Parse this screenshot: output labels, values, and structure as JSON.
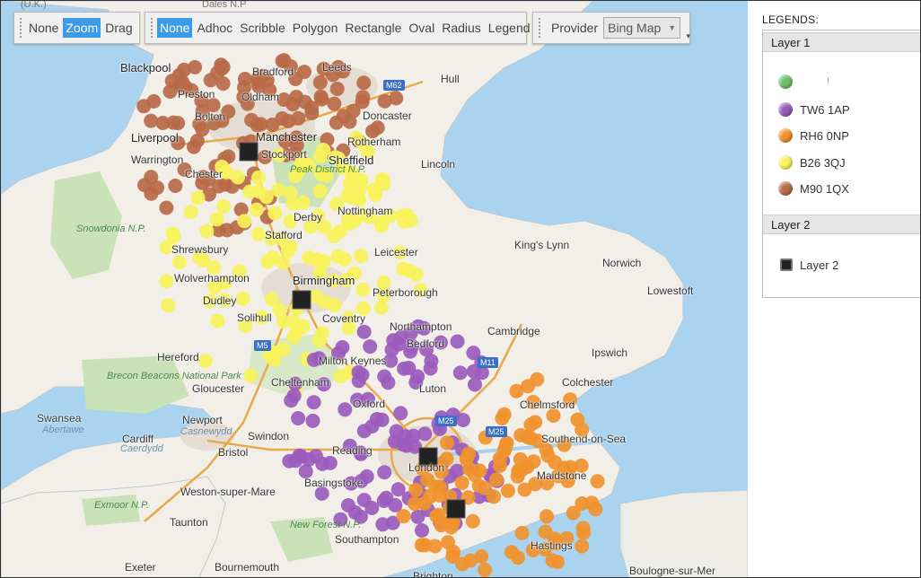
{
  "toolbar": {
    "zoom_group": [
      {
        "label": "None",
        "active": false
      },
      {
        "label": "Zoom",
        "active": true
      },
      {
        "label": "Drag",
        "active": false
      }
    ],
    "draw_group": [
      {
        "label": "None",
        "active": true
      },
      {
        "label": "Adhoc",
        "active": false
      },
      {
        "label": "Scribble",
        "active": false
      },
      {
        "label": "Polygon",
        "active": false
      },
      {
        "label": "Rectangle",
        "active": false
      },
      {
        "label": "Oval",
        "active": false
      },
      {
        "label": "Radius",
        "active": false
      },
      {
        "label": "Legend",
        "active": false
      }
    ],
    "provider_label": "Provider",
    "provider_value": "Bing Map"
  },
  "map": {
    "top_fragments": [
      "(U.K.)",
      "Dales N.P"
    ],
    "places": [
      "Blackpool",
      "Preston",
      "Bradford",
      "Leeds",
      "Hull",
      "Bolton",
      "Oldham",
      "Liverpool",
      "Manchester",
      "Doncaster",
      "Warrington",
      "Stockport",
      "Sheffield",
      "Rotherham",
      "Chester",
      "Lincoln",
      "Peak District N.P.",
      "Derby",
      "Nottingham",
      "Snowdonia N.P.",
      "Stafford",
      "Shrewsbury",
      "Leicester",
      "King's Lynn",
      "Norwich",
      "Wolverhampton",
      "Birmingham",
      "Peterborough",
      "Lowestoft",
      "Dudley",
      "Solihull",
      "Coventry",
      "Northampton",
      "Cambridge",
      "Hereford",
      "Bedford",
      "Ipswich",
      "Brecon Beacons National Park",
      "Cheltenham",
      "Milton Keynes",
      "Luton",
      "Colchester",
      "Gloucester",
      "Oxford",
      "Chelmsford",
      "Swansea",
      "Abertawe",
      "Newport",
      "Casnewydd",
      "Swindon",
      "Southend-on-Sea",
      "Cardiff",
      "Caerdydd",
      "Bristol",
      "Reading",
      "London",
      "Basingstoke",
      "Maidstone",
      "Weston-super-Mare",
      "Exmoor N.P.",
      "Taunton",
      "New Forest N.P.",
      "Southampton",
      "Hastings",
      "Exeter",
      "Bournemouth",
      "Brighton",
      "Boulogne-sur-Mer"
    ],
    "roads": [
      "M62",
      "M5",
      "M11",
      "M25",
      "M25"
    ],
    "colors": {
      "water": "#a9d3ef",
      "land": "#f2efe9",
      "park": "#c9e2b8",
      "urban": "#e6e0d8",
      "motorway": "#e8a84c"
    }
  },
  "legend": {
    "title": "LEGENDS:",
    "layers": [
      {
        "name": "Layer 1",
        "items": [
          {
            "label": "",
            "color": "#6cc06c",
            "kind": "dot"
          },
          {
            "label": "TW6 1AP",
            "color": "#9b5bbd",
            "kind": "dot"
          },
          {
            "label": "RH6 0NP",
            "color": "#f0922e",
            "kind": "dot"
          },
          {
            "label": "B26 3QJ",
            "color": "#f7f35a",
            "kind": "dot"
          },
          {
            "label": "M90 1QX",
            "color": "#b86a48",
            "kind": "dot"
          }
        ]
      },
      {
        "name": "Layer 2",
        "items": [
          {
            "label": "Layer 2",
            "color": "#222222",
            "kind": "square"
          }
        ]
      }
    ]
  },
  "icons": {
    "layer2_marker": "square-marker-icon",
    "legend_marker": "circle-marker-icon",
    "dropdown": "chevron-down-icon",
    "toolbar_overflow": "overflow-icon"
  }
}
